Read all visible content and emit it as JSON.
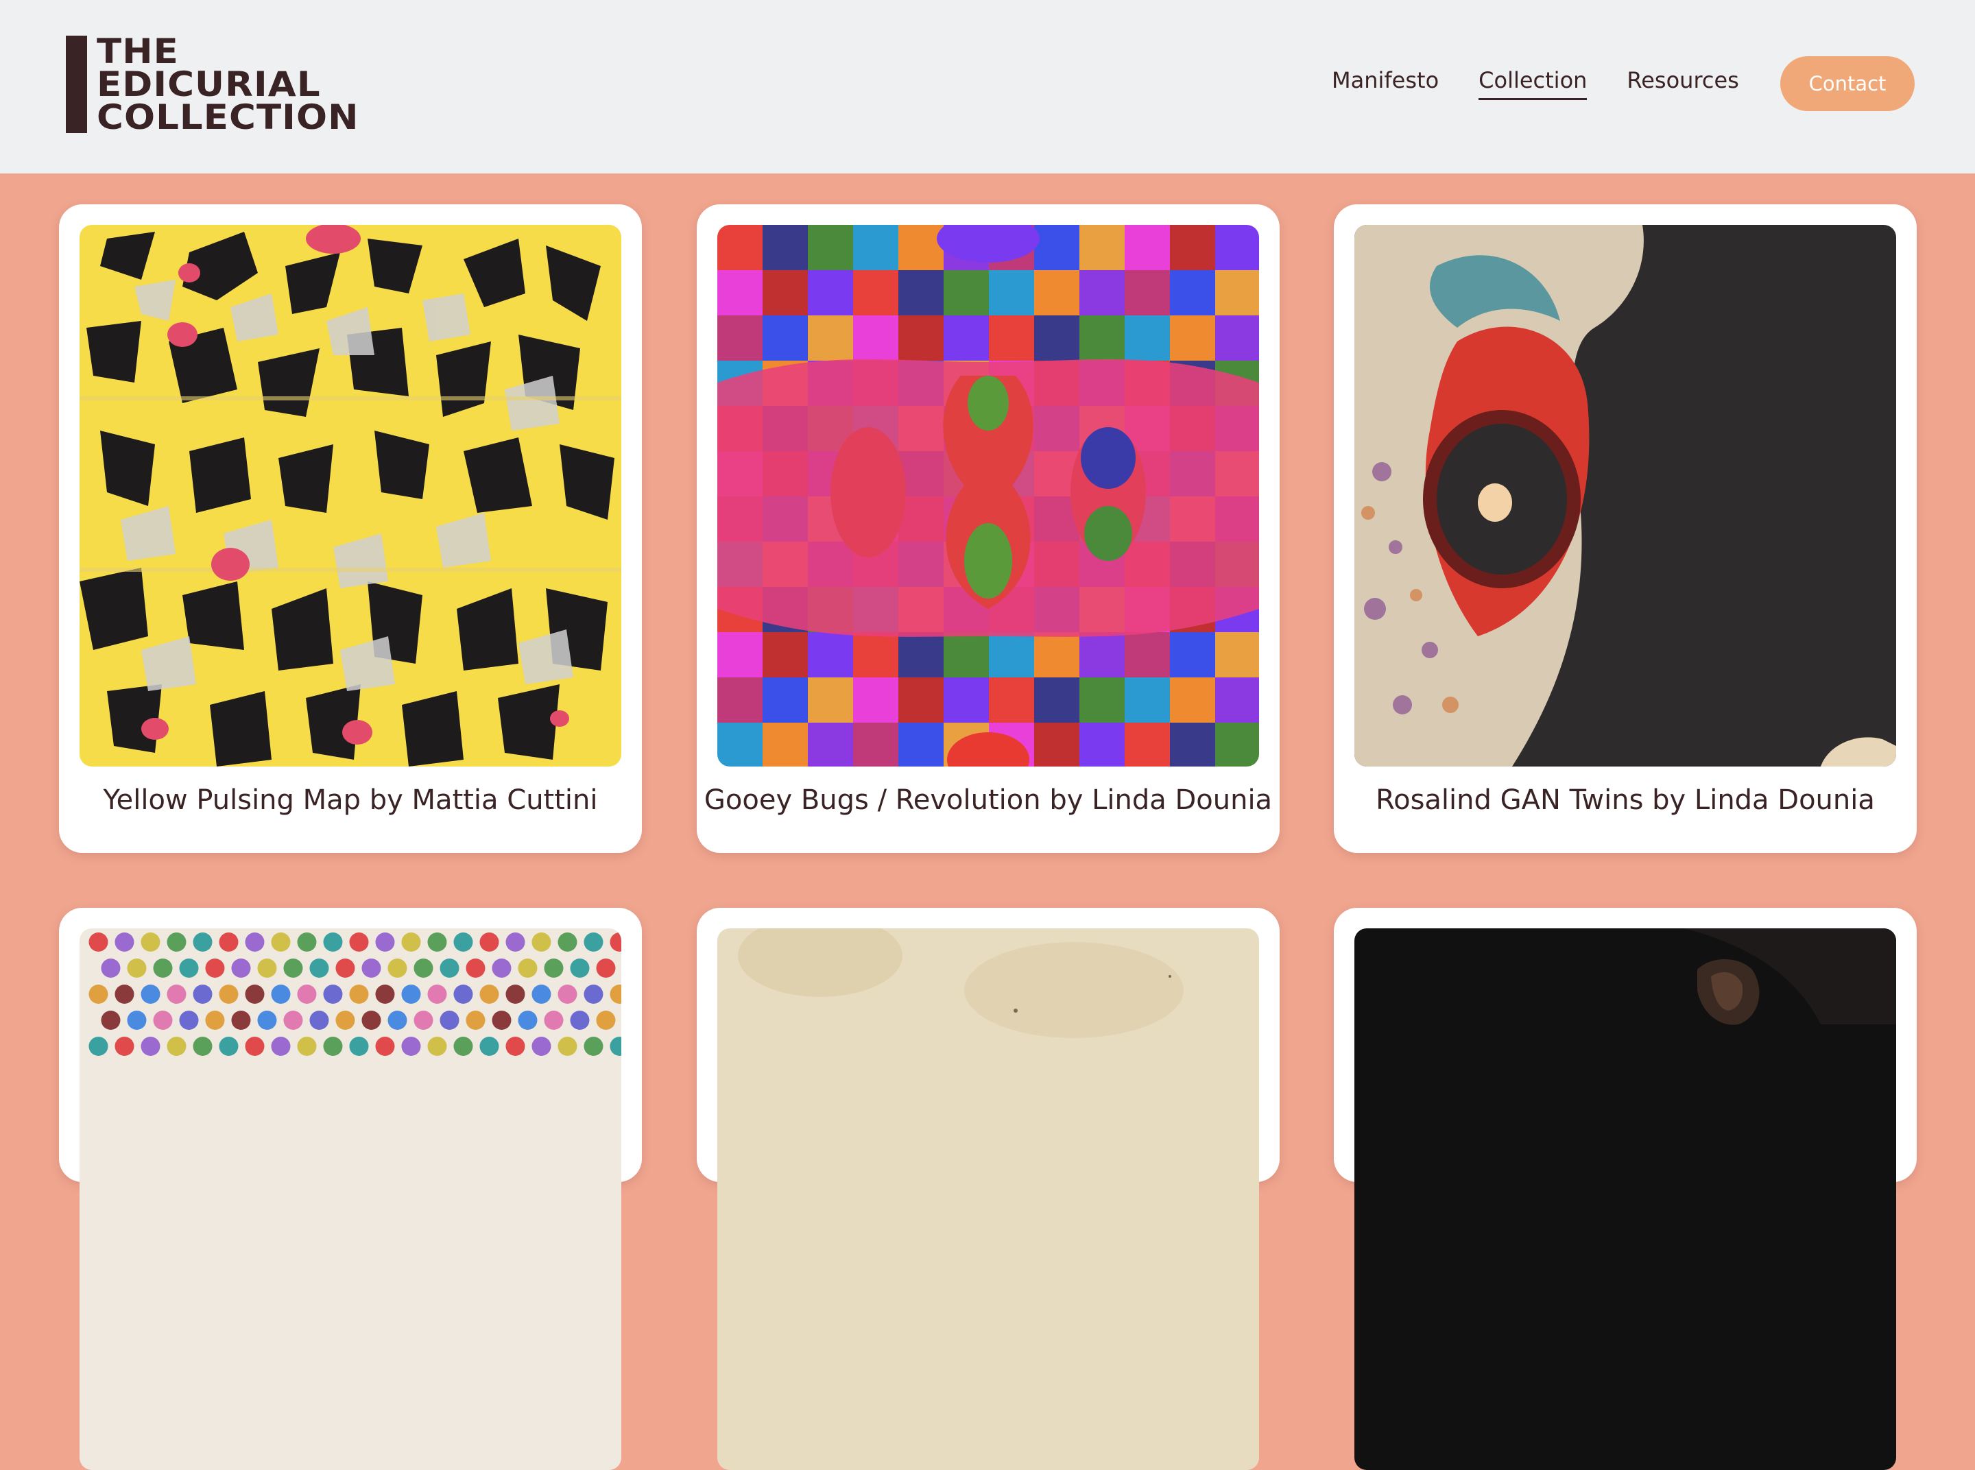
{
  "header": {
    "logo_lines": [
      "THE",
      "EDICURIAL",
      "COLLECTION"
    ],
    "nav": [
      {
        "label": "Manifesto",
        "active": false
      },
      {
        "label": "Collection",
        "active": true
      },
      {
        "label": "Resources",
        "active": false
      }
    ],
    "contact_label": "Contact"
  },
  "colors": {
    "page_background": "#f0a58f",
    "header_background": "#eff0f1",
    "text_dark": "#3a2325",
    "contact_button": "#f0a878",
    "card_background": "#ffffff"
  },
  "collection": {
    "cards": [
      {
        "caption": "Yellow Pulsing Map by Mattia Cuttini"
      },
      {
        "caption": "Gooey Bugs / Revolution by Linda Dounia"
      },
      {
        "caption": "Rosalind GAN Twins by Linda Dounia"
      },
      {
        "caption": ""
      },
      {
        "caption": ""
      },
      {
        "caption": ""
      }
    ]
  }
}
